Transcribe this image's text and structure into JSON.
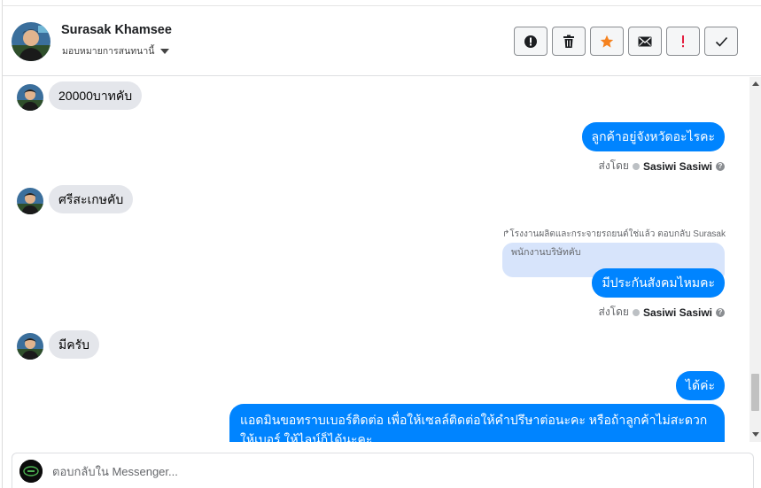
{
  "header": {
    "name": "Surasak Khamsee",
    "assign_label": "มอบหมายการสนทนานี้",
    "actions": [
      {
        "name": "spam-alert",
        "icon": "alert-circle-icon"
      },
      {
        "name": "delete",
        "icon": "trash-icon"
      },
      {
        "name": "star",
        "icon": "star-icon",
        "color": "#f5821f"
      },
      {
        "name": "mark-unread",
        "icon": "envelope-icon"
      },
      {
        "name": "important",
        "icon": "exclamation-icon",
        "color": "#e41e3f"
      },
      {
        "name": "done",
        "icon": "checkmark-icon"
      }
    ]
  },
  "messages": {
    "m1": {
      "text": "20000บาทคับ"
    },
    "m2": {
      "text": "ลูกค้าอยู่จังหวัดอะไรคะ",
      "sent_by_label": "ส่งโดย",
      "sender": "Sasiwi Sasiwi"
    },
    "m3": {
      "text": "ศรีสะเกษคับ"
    },
    "m4": {
      "reply_note": "↱โรงงานผลิตและกระจายรถยนต์ใช่แล้ว ตอบกลับ Surasak",
      "quoted": "พนักงานบริษัทคับ",
      "text": "มีประกันสังคมไหมคะ",
      "sent_by_label": "ส่งโดย",
      "sender": "Sasiwi Sasiwi"
    },
    "m5": {
      "text": "มีครับ"
    },
    "m6": {
      "text": "ได้ค่ะ"
    },
    "m7": {
      "text": "แอดมินขอทราบเบอร์ติดต่อ เพื่อให้เซลล์ติดต่อให้คำปรึษาต่อนะคะ หรือถ้าลูกค้าไม่สะดวกให้เบอร์ ให้ไลน์ก็ได้นะคะ"
    }
  },
  "composer": {
    "placeholder": "ตอบกลับใน Messenger..."
  },
  "colors": {
    "outgoing_bubble": "#0084ff",
    "incoming_bubble": "#e4e6eb",
    "quoted_bubble": "#d7e4fb"
  }
}
